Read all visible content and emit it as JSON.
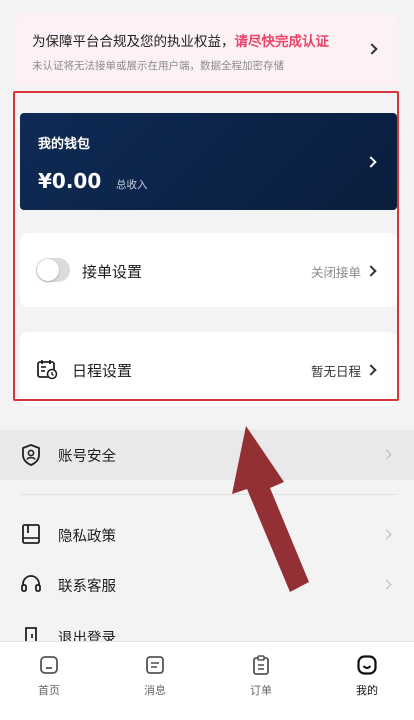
{
  "notice": {
    "line1_prefix": "为保障平台合规及您的执业权益，",
    "line1_warn": "请尽快完成认证",
    "line2": "未认证将无法接单或展示在用户端，数据全程加密存储"
  },
  "wallet": {
    "title": "我的钱包",
    "amount": "¥0.00",
    "amount_label": "总收入"
  },
  "order_settings": {
    "label": "接单设置",
    "status": "关闭接单",
    "toggle_on": false
  },
  "schedule_settings": {
    "label": "日程设置",
    "status": "暂无日程"
  },
  "menu": [
    {
      "label": "账号安全",
      "icon": "shield-user-icon"
    },
    {
      "label": "隐私政策",
      "icon": "book-icon"
    },
    {
      "label": "联系客服",
      "icon": "headset-icon"
    },
    {
      "label": "退出登录",
      "icon": "logout-icon"
    }
  ],
  "tabbar": [
    {
      "label": "首页",
      "icon": "home-icon",
      "active": false
    },
    {
      "label": "消息",
      "icon": "message-icon",
      "active": false
    },
    {
      "label": "订单",
      "icon": "clipboard-icon",
      "active": false
    },
    {
      "label": "我的",
      "icon": "smile-icon",
      "active": true
    }
  ],
  "colors": {
    "warn": "#e8456a",
    "wallet_bg": "#0f2a55",
    "highlight": "#d9343a",
    "arrow": "#8b1f24"
  }
}
